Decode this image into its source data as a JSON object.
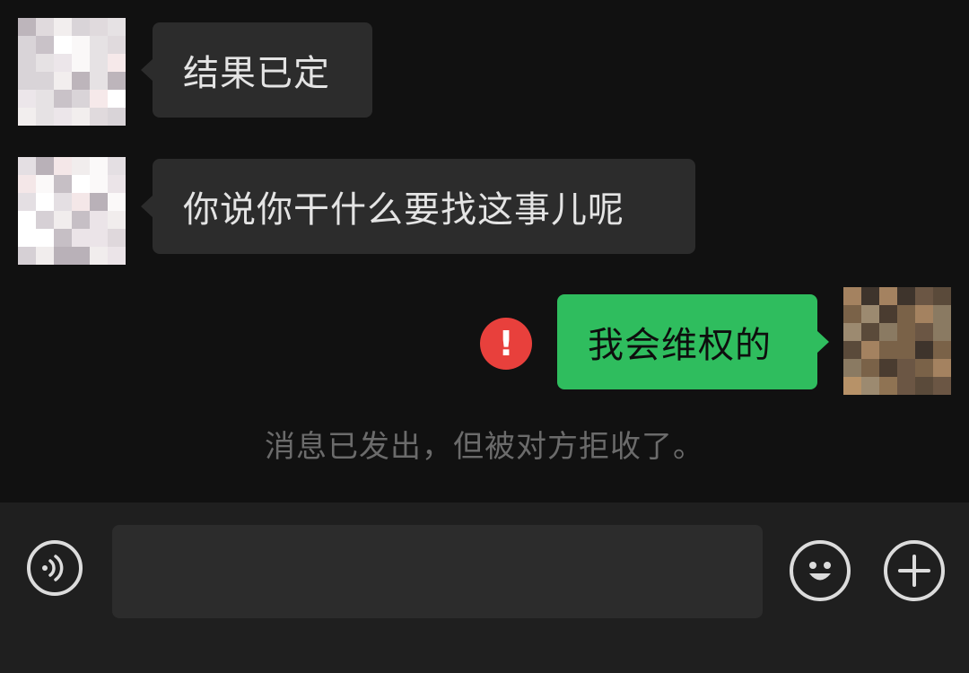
{
  "messages": [
    {
      "side": "in",
      "text": "结果已定"
    },
    {
      "side": "in",
      "text": "你说你干什么要找这事儿呢"
    },
    {
      "side": "out",
      "text": "我会维权的",
      "status": "failed"
    }
  ],
  "error_icon_glyph": "!",
  "system_notice": "消息已发出，但被对方拒收了。",
  "input": {
    "value": "",
    "placeholder": ""
  },
  "colors": {
    "background": "#111111",
    "incoming_bubble": "#2c2c2c",
    "outgoing_bubble": "#2fbd5e",
    "error": "#e8403c",
    "input_bar": "#1f1f1f"
  },
  "icons": {
    "voice": "voice-icon",
    "emoji": "emoji-icon",
    "more": "plus-icon"
  }
}
